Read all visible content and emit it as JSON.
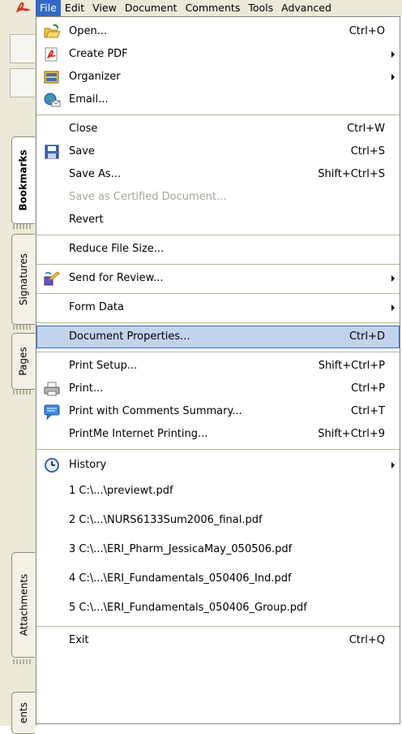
{
  "menubar": {
    "items": [
      "File",
      "Edit",
      "View",
      "Document",
      "Comments",
      "Tools",
      "Advanced"
    ]
  },
  "side_tabs": {
    "bookmarks": "Bookmarks",
    "signatures": "Signatures",
    "pages": "Pages",
    "attachments": "Attachments",
    "comments_partial": "ents"
  },
  "file_menu": {
    "open": {
      "label": "Open...",
      "shortcut": "Ctrl+O"
    },
    "create_pdf": {
      "label": "Create PDF"
    },
    "organizer": {
      "label": "Organizer"
    },
    "email": {
      "label": "Email..."
    },
    "close": {
      "label": "Close",
      "shortcut": "Ctrl+W"
    },
    "save": {
      "label": "Save",
      "shortcut": "Ctrl+S"
    },
    "save_as": {
      "label": "Save As...",
      "shortcut": "Shift+Ctrl+S"
    },
    "save_certified": {
      "label": "Save as Certified Document..."
    },
    "revert": {
      "label": "Revert"
    },
    "reduce_size": {
      "label": "Reduce File Size..."
    },
    "send_review": {
      "label": "Send for Review..."
    },
    "form_data": {
      "label": "Form Data"
    },
    "doc_properties": {
      "label": "Document Properties...",
      "shortcut": "Ctrl+D"
    },
    "print_setup": {
      "label": "Print Setup...",
      "shortcut": "Shift+Ctrl+P"
    },
    "print": {
      "label": "Print...",
      "shortcut": "Ctrl+P"
    },
    "print_comments": {
      "label": "Print with Comments Summary...",
      "shortcut": "Ctrl+T"
    },
    "printme": {
      "label": "PrintMe Internet Printing...",
      "shortcut": "Shift+Ctrl+9"
    },
    "history": {
      "label": "History"
    },
    "recent": [
      "1 C:\\...\\previewt.pdf",
      "2 C:\\...\\NURS6133Sum2006_final.pdf",
      "3 C:\\...\\ERI_Pharm_JessicaMay_050506.pdf",
      "4 C:\\...\\ERI_Fundamentals_050406_Ind.pdf",
      "5 C:\\...\\ERI_Fundamentals_050406_Group.pdf"
    ],
    "exit": {
      "label": "Exit",
      "shortcut": "Ctrl+Q"
    }
  },
  "colors": {
    "menu_highlight": "#316ac5",
    "item_highlight": "#c2d3ee",
    "chrome": "#ece9d8",
    "disabled_text": "#a7a59a"
  }
}
